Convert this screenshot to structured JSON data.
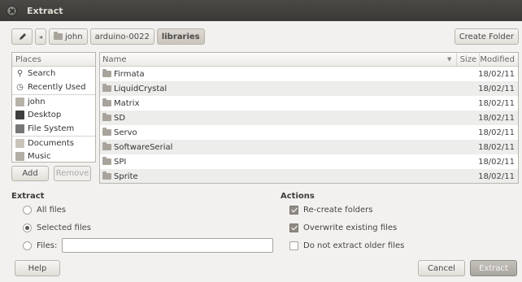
{
  "window": {
    "title": "Extract"
  },
  "pathbar": {
    "crumbs": [
      {
        "label": "john",
        "active": false
      },
      {
        "label": "arduino-0022",
        "active": false
      },
      {
        "label": "libraries",
        "active": true
      }
    ],
    "create_folder": "Create Folder"
  },
  "places": {
    "header": "Places",
    "items": [
      {
        "label": "Search",
        "icon": "search-icon"
      },
      {
        "label": "Recently Used",
        "icon": "recent-icon"
      },
      {
        "label": "john",
        "icon": "home-folder-icon"
      },
      {
        "label": "Desktop",
        "icon": "desktop-icon"
      },
      {
        "label": "File System",
        "icon": "filesystem-icon"
      },
      {
        "label": "Documents",
        "icon": "documents-icon"
      },
      {
        "label": "Music",
        "icon": "music-icon"
      }
    ],
    "add": "Add",
    "remove": "Remove"
  },
  "files": {
    "columns": {
      "name": "Name",
      "size": "Size",
      "modified": "Modified"
    },
    "rows": [
      {
        "name": "Firmata",
        "size": "",
        "modified": "18/02/11"
      },
      {
        "name": "LiquidCrystal",
        "size": "",
        "modified": "18/02/11"
      },
      {
        "name": "Matrix",
        "size": "",
        "modified": "18/02/11"
      },
      {
        "name": "SD",
        "size": "",
        "modified": "18/02/11"
      },
      {
        "name": "Servo",
        "size": "",
        "modified": "18/02/11"
      },
      {
        "name": "SoftwareSerial",
        "size": "",
        "modified": "18/02/11"
      },
      {
        "name": "SPI",
        "size": "",
        "modified": "18/02/11"
      },
      {
        "name": "Sprite",
        "size": "",
        "modified": "18/02/11"
      }
    ]
  },
  "extract": {
    "label": "Extract",
    "all_files": "All files",
    "selected_files": "Selected files",
    "files_label": "Files:",
    "files_value": "",
    "selected": "selected_files"
  },
  "actions": {
    "label": "Actions",
    "recreate": {
      "label": "Re-create folders",
      "checked": true
    },
    "overwrite": {
      "label": "Overwrite existing files",
      "checked": true
    },
    "no_older": {
      "label": "Do not extract older files",
      "checked": false
    }
  },
  "footer": {
    "help": "Help",
    "cancel": "Cancel",
    "extract": "Extract"
  }
}
